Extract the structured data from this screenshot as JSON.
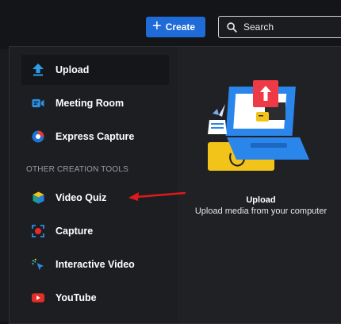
{
  "header": {
    "create_label": "Create",
    "search_placeholder": "Search"
  },
  "menu": {
    "items": [
      {
        "label": "Upload",
        "icon": "upload-arrow-icon"
      },
      {
        "label": "Meeting Room",
        "icon": "meeting-camera-icon"
      },
      {
        "label": "Express Capture",
        "icon": "express-capture-icon"
      }
    ],
    "section_label": "OTHER CREATION TOOLS",
    "other_items": [
      {
        "label": "Video Quiz",
        "icon": "video-quiz-cube-icon"
      },
      {
        "label": "Capture",
        "icon": "capture-record-icon"
      },
      {
        "label": "Interactive Video",
        "icon": "interactive-cursor-icon"
      },
      {
        "label": "YouTube",
        "icon": "youtube-icon"
      }
    ]
  },
  "preview": {
    "title": "Upload",
    "description": "Upload media from your computer"
  },
  "colors": {
    "accent": "#1f6bd8",
    "annotation_arrow": "#e0191c",
    "youtube_red": "#e52d27"
  }
}
